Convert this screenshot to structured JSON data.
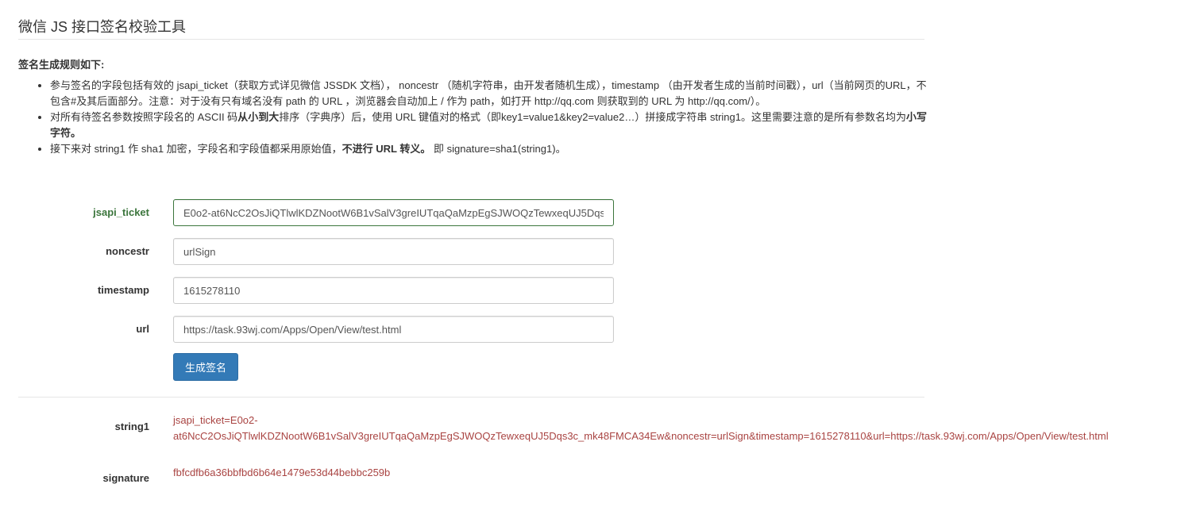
{
  "page": {
    "title": "微信 JS 接口签名校验工具"
  },
  "rules": {
    "title": "签名生成规则如下:",
    "item1": "参与签名的字段包括有效的 jsapi_ticket（获取方式详见微信 JSSDK 文档）， noncestr （随机字符串，由开发者随机生成），timestamp （由开发者生成的当前时间戳），url（当前网页的URL，不包含#及其后面部分。注意：对于没有只有域名没有 path 的 URL ，浏览器会自动加上 / 作为 path，如打开 http://qq.com 则获取到的 URL 为 http://qq.com/）。",
    "item2_a": "对所有待签名参数按照字段名的 ASCII 码",
    "item2_b": "从小到大",
    "item2_c": "排序（字典序）后，使用 URL 键值对的格式（即key1=value1&key2=value2…）拼接成字符串 string1。这里需要注意的是所有参数名均为",
    "item2_d": "小写字符。",
    "item3_a": "接下来对 string1 作 sha1 加密，字段名和字段值都采用原始值，",
    "item3_b": "不进行 URL 转义。",
    "item3_c": "即 signature=sha1(string1)。"
  },
  "form": {
    "jsapi_ticket": {
      "label": "jsapi_ticket",
      "value": "E0o2-at6NcC2OsJiQTlwlKDZNootW6B1vSalV3greIUTqaQaMzpEgSJWOQzTewxeqUJ5Dqs3c_mk48FMCA34Ew"
    },
    "noncestr": {
      "label": "noncestr",
      "value": "urlSign"
    },
    "timestamp": {
      "label": "timestamp",
      "value": "1615278110"
    },
    "url": {
      "label": "url",
      "value": "https://task.93wj.com/Apps/Open/View/test.html"
    },
    "submit_label": "生成签名"
  },
  "result": {
    "string1_label": "string1",
    "string1_line1": "jsapi_ticket=E0o2-",
    "string1_line2": "at6NcC2OsJiQTlwlKDZNootW6B1vSalV3greIUTqaQaMzpEgSJWOQzTewxeqUJ5Dqs3c_mk48FMCA34Ew&noncestr=urlSign&timestamp=1615278110&url=https://task.93wj.com/Apps/Open/View/test.html",
    "signature_label": "signature",
    "signature_value": "fbfcdfb6a36bbfbd6b64e1479e53d44bebbc259b"
  },
  "colors": {
    "primary": "#337ab7",
    "success": "#3c763d",
    "danger": "#a94442"
  }
}
